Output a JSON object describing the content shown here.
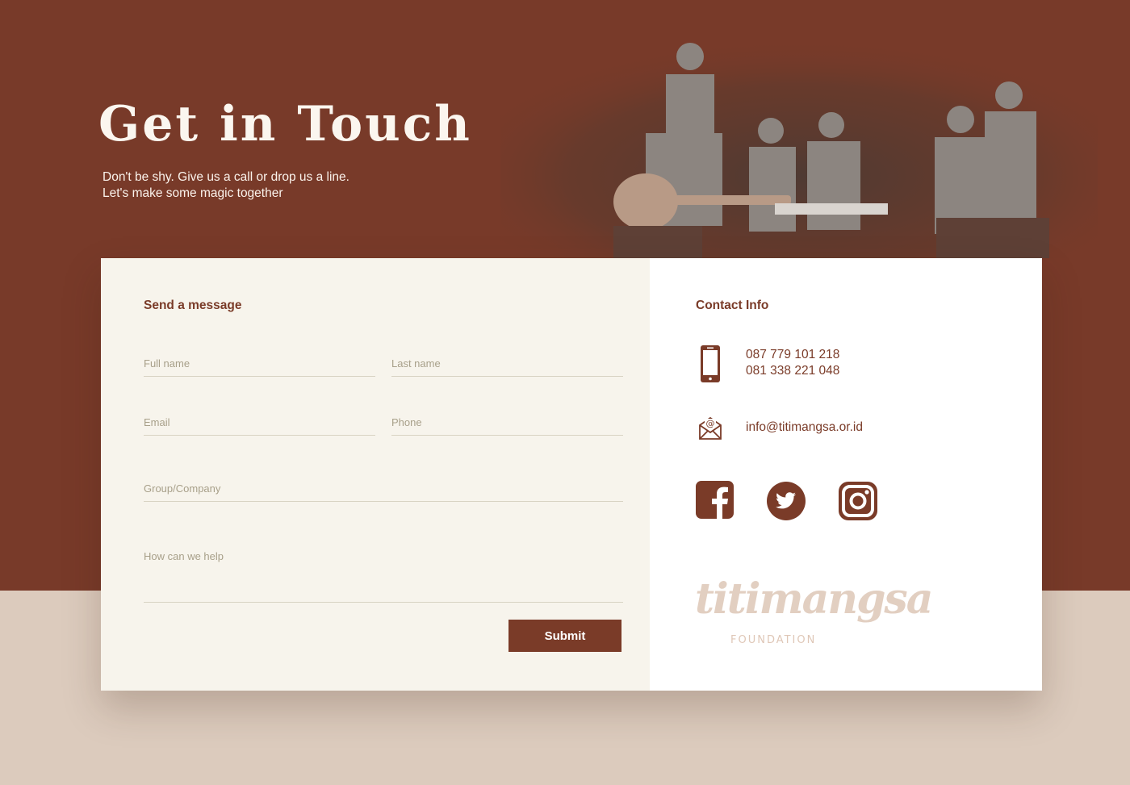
{
  "hero": {
    "title": "Get in Touch",
    "subtitle_line1": "Don't be shy. Give us a call or drop us a line.",
    "subtitle_line2": "Let's make some magic together"
  },
  "form": {
    "heading": "Send a message",
    "first_name_placeholder": "Full name",
    "last_name_placeholder": "Last name",
    "email_placeholder": "Email",
    "phone_placeholder": "Phone",
    "company_placeholder": "Group/Company",
    "help_placeholder": "How can we help",
    "submit_label": "Submit"
  },
  "contact": {
    "heading": "Contact Info",
    "phone_1": "087 779 101 218",
    "phone_2": "081 338 221 048",
    "email": "info@titimangsa.or.id",
    "icons": {
      "phone": "mobile-phone-icon",
      "email": "envelope-at-icon",
      "facebook": "facebook-icon",
      "twitter": "twitter-icon",
      "instagram": "instagram-icon"
    }
  },
  "logo": {
    "name": "titimangsa",
    "subtitle": "FOUNDATION"
  },
  "colors": {
    "brand": "#7a3b28",
    "hero_background": "#783a29",
    "page_background": "#dccbbd",
    "form_background": "#f7f4ec",
    "info_background": "#ffffff"
  }
}
